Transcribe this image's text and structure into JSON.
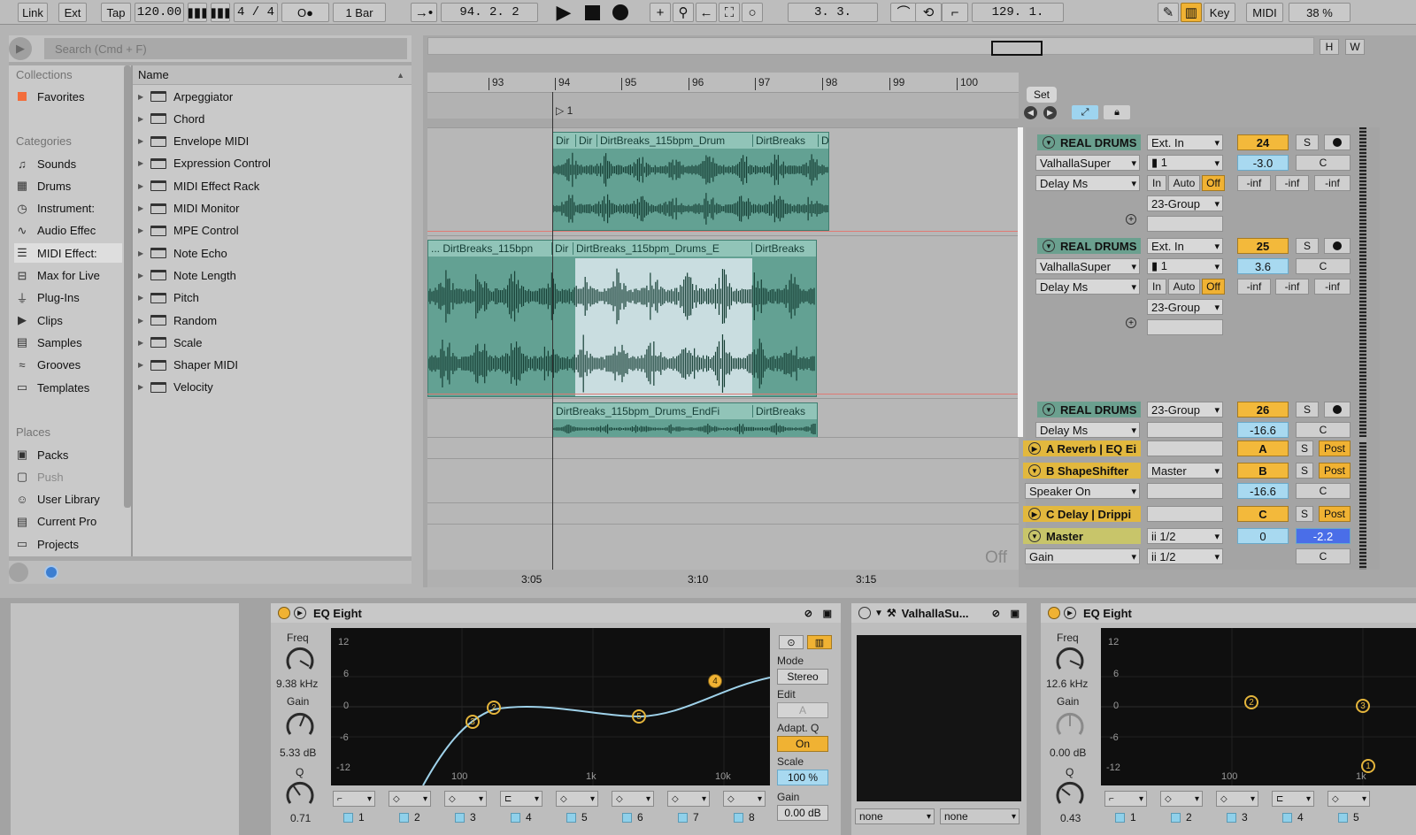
{
  "toolbar": {
    "link": "Link",
    "ext": "Ext",
    "tap": "Tap",
    "tempo": "120.00",
    "signature": "4 / 4",
    "metro": "O●",
    "quantize": "1 Bar",
    "position": "94.  2.  2",
    "loop_start": "3.  3.",
    "loop_length": "129.  1.",
    "key": "Key",
    "midi": "MIDI",
    "cpu": "38 %"
  },
  "browser": {
    "search_placeholder": "Search (Cmd + F)",
    "collections_label": "Collections",
    "favorites": "Favorites",
    "categories_label": "Categories",
    "categories": [
      {
        "label": "Sounds",
        "icon": "music-note-icon"
      },
      {
        "label": "Drums",
        "icon": "grid-icon"
      },
      {
        "label": "Instrument:",
        "icon": "clock-icon"
      },
      {
        "label": "Audio Effec",
        "icon": "waveform-icon"
      },
      {
        "label": "MIDI Effect:",
        "icon": "midi-icon"
      },
      {
        "label": "Max for Live",
        "icon": "max-icon"
      },
      {
        "label": "Plug-Ins",
        "icon": "plug-icon"
      },
      {
        "label": "Clips",
        "icon": "play-icon"
      },
      {
        "label": "Samples",
        "icon": "samples-icon"
      },
      {
        "label": "Grooves",
        "icon": "wave-icon"
      },
      {
        "label": "Templates",
        "icon": "template-icon"
      }
    ],
    "places_label": "Places",
    "places": [
      {
        "label": "Packs",
        "icon": "packs-icon"
      },
      {
        "label": "Push",
        "icon": "push-icon"
      },
      {
        "label": "User Library",
        "icon": "user-icon"
      },
      {
        "label": "Current Pro",
        "icon": "project-icon"
      },
      {
        "label": "Projects",
        "icon": "folder-icon"
      }
    ],
    "name_header": "Name",
    "items": [
      "Arpeggiator",
      "Chord",
      "Envelope MIDI",
      "Expression Control",
      "MIDI Effect Rack",
      "MIDI Monitor",
      "MPE Control",
      "Note Echo",
      "Note Length",
      "Pitch",
      "Random",
      "Scale",
      "Shaper MIDI",
      "Velocity"
    ]
  },
  "arrangement": {
    "bars": [
      "93",
      "94",
      "95",
      "96",
      "97",
      "98",
      "99",
      "100"
    ],
    "marker": "1",
    "set_label": "Set",
    "hw": [
      "H",
      "W"
    ],
    "lane1_clip": [
      "Dir",
      "Dir",
      "DirtBreaks_115bpm_Drum",
      "DirtBreaks",
      "Di"
    ],
    "lane2_clip": [
      "... DirtBreaks_115bpn",
      "Dir",
      "DirtBreaks_115bpm_Drums_E",
      "DirtBreaks"
    ],
    "lane3_clip": [
      "DirtBreaks_115bpm_Drums_EndFi",
      "DirtBreaks"
    ],
    "times": [
      "3:05",
      "3:10",
      "3:15"
    ],
    "off_label": "Off"
  },
  "mixer": {
    "tracks": [
      {
        "name": "REAL DRUMS",
        "input": "Ext. In",
        "instrument": "ValhallaSuper",
        "channel": "▮ 1",
        "device": "Delay Ms",
        "group": "23-Group",
        "number": "24",
        "volume": "-3.0",
        "pan": "C",
        "in": "In",
        "auto": "Auto",
        "off": "Off",
        "sends": [
          "-inf",
          "-inf",
          "-inf"
        ]
      },
      {
        "name": "REAL DRUMS",
        "input": "Ext. In",
        "instrument": "ValhallaSuper",
        "channel": "▮ 1",
        "device": "Delay Ms",
        "group": "23-Group",
        "number": "25",
        "volume": "3.6",
        "pan": "C",
        "in": "In",
        "auto": "Auto",
        "off": "Off",
        "sends": [
          "-inf",
          "-inf",
          "-inf"
        ]
      },
      {
        "name": "REAL DRUMS",
        "group": "23-Group",
        "device": "Delay Ms",
        "number": "26",
        "volume": "-16.6",
        "pan": "C"
      }
    ],
    "returns": [
      {
        "name": "A Reverb | EQ Ei",
        "letter": "A",
        "post": "Post"
      },
      {
        "name": "B ShapeShifter",
        "output": "Master",
        "letter": "B",
        "post": "Post",
        "device": "Speaker On",
        "volume": "-16.6",
        "pan": "C"
      },
      {
        "name": "C Delay | Drippi",
        "letter": "C",
        "post": "Post"
      }
    ],
    "master": {
      "name": "Master",
      "device": "Gain",
      "cue": "ii 1/2",
      "out": "ii 1/2",
      "number": "0",
      "volume": "-2.2",
      "pan": "C"
    },
    "solo": "S"
  },
  "devices": {
    "eq1": {
      "title": "EQ Eight",
      "freq_label": "Freq",
      "freq": "9.38 kHz",
      "gain_label": "Gain",
      "gain": "5.33 dB",
      "q_label": "Q",
      "q": "0.71",
      "db_labels": [
        "12",
        "6",
        "0",
        "-6",
        "-12"
      ],
      "freq_labels": [
        "100",
        "1k",
        "10k"
      ],
      "mode_label": "Mode",
      "mode": "Stereo",
      "edit_label": "Edit",
      "edit": "A",
      "adapt_label": "Adapt. Q",
      "adapt": "On",
      "scale_label": "Scale",
      "scale": "100 %",
      "gain2_label": "Gain",
      "gain2": "0.00 dB",
      "bands": [
        "1",
        "2",
        "3",
        "4",
        "5",
        "6",
        "7",
        "8"
      ],
      "nodes": [
        "3",
        "2",
        "5",
        "4"
      ]
    },
    "valhalla": {
      "title": "ValhallaSu...",
      "sel1": "none",
      "sel2": "none"
    },
    "eq2": {
      "title": "EQ Eight",
      "freq_label": "Freq",
      "freq": "12.6 kHz",
      "gain_label": "Gain",
      "gain": "0.00 dB",
      "q_label": "Q",
      "q": "0.43",
      "db_labels": [
        "12",
        "6",
        "0",
        "-6",
        "-12"
      ],
      "freq_labels": [
        "100",
        "1k"
      ],
      "bands": [
        "1",
        "2",
        "3",
        "4",
        "5"
      ],
      "nodes": [
        "2",
        "3",
        "1"
      ]
    }
  },
  "colors": {
    "accent": "#f0b233",
    "clip": "#63a193",
    "clip_head": "#91c4b8",
    "selection": "#ebf2fa",
    "volume": "#a8d9f0"
  }
}
